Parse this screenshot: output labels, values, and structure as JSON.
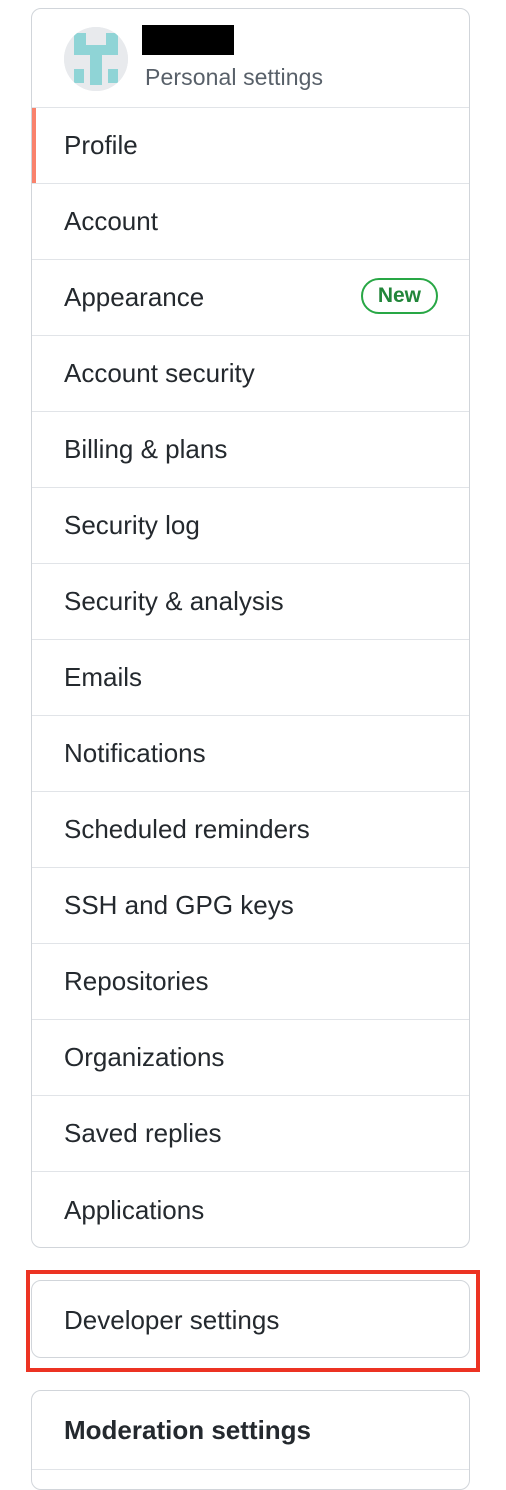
{
  "profile": {
    "subtitle": "Personal settings",
    "avatar_colors": {
      "bg": "#e8eaed",
      "fg": "#8fd4d6"
    }
  },
  "nav": {
    "items": [
      {
        "label": "Profile",
        "selected": true
      },
      {
        "label": "Account"
      },
      {
        "label": "Appearance",
        "badge": "New"
      },
      {
        "label": "Account security"
      },
      {
        "label": "Billing & plans"
      },
      {
        "label": "Security log"
      },
      {
        "label": "Security & analysis"
      },
      {
        "label": "Emails"
      },
      {
        "label": "Notifications"
      },
      {
        "label": "Scheduled reminders"
      },
      {
        "label": "SSH and GPG keys"
      },
      {
        "label": "Repositories"
      },
      {
        "label": "Organizations"
      },
      {
        "label": "Saved replies"
      },
      {
        "label": "Applications"
      }
    ]
  },
  "developer": {
    "label": "Developer settings"
  },
  "moderation": {
    "title": "Moderation settings"
  },
  "colors": {
    "selected_indicator": "#f9826c",
    "badge_green": "#28a745",
    "highlight_red": "#ec3323"
  }
}
